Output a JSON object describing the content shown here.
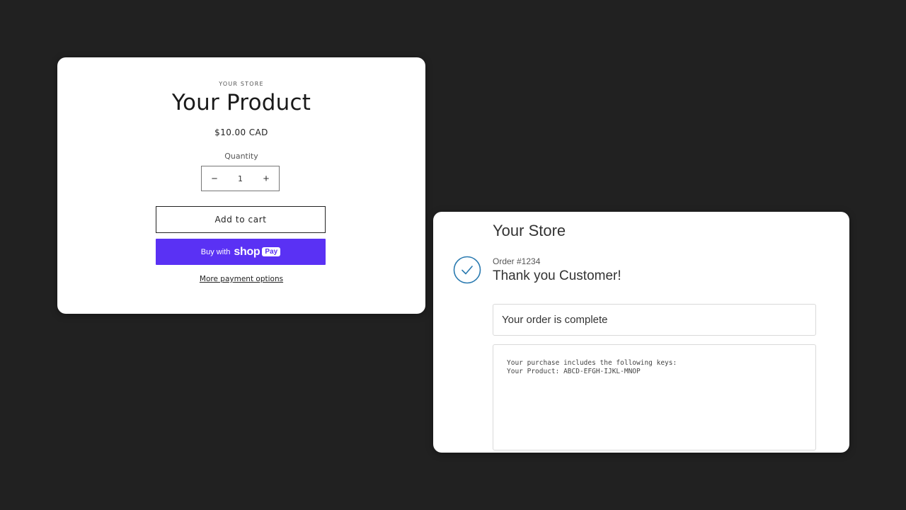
{
  "product_card": {
    "vendor": "YOUR STORE",
    "title": "Your Product",
    "price": "$10.00 CAD",
    "quantity_label": "Quantity",
    "quantity_value": "1",
    "decrement_symbol": "−",
    "increment_symbol": "+",
    "add_to_cart_label": "Add to cart",
    "shop_pay": {
      "buy_with": "Buy with",
      "shop": "shop",
      "pay": "Pay",
      "color": "#5a31f4"
    },
    "more_payment_label": "More payment options"
  },
  "order_card": {
    "store_name": "Your Store",
    "order_number": "Order #1234",
    "thank_you": "Thank you Customer!",
    "status_message": "Your order is complete",
    "keys_line_1": "Your purchase includes the following keys:",
    "keys_line_2": "Your Product: ABCD-EFGH-IJKL-MNOP",
    "check_icon": "check-circle-icon",
    "accent_color": "#2a7ab0"
  }
}
